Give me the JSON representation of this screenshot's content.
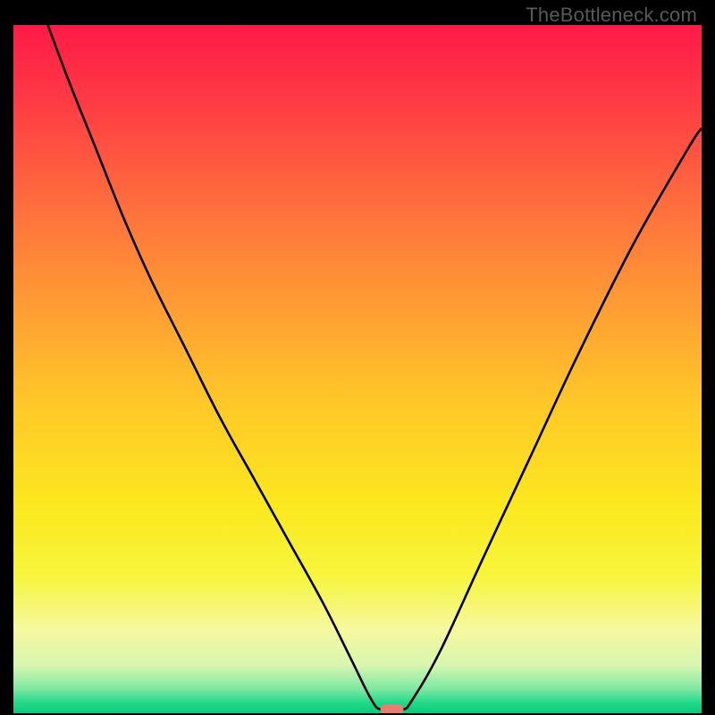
{
  "watermark": "TheBottleneck.com",
  "chart_data": {
    "type": "line",
    "title": "",
    "xlabel": "",
    "ylabel": "",
    "xlim": [
      0,
      100
    ],
    "ylim": [
      0,
      100
    ],
    "grid": false,
    "background_gradient": {
      "stops": [
        {
          "offset": 0.0,
          "color": "#ff1a48"
        },
        {
          "offset": 0.1,
          "color": "#ff3745"
        },
        {
          "offset": 0.25,
          "color": "#ff6a3e"
        },
        {
          "offset": 0.4,
          "color": "#ff9a35"
        },
        {
          "offset": 0.55,
          "color": "#ffc828"
        },
        {
          "offset": 0.7,
          "color": "#fbe81f"
        },
        {
          "offset": 0.8,
          "color": "#f7f53c"
        },
        {
          "offset": 0.88,
          "color": "#f5f8a0"
        },
        {
          "offset": 0.93,
          "color": "#d8f6b0"
        },
        {
          "offset": 0.965,
          "color": "#7de8a2"
        },
        {
          "offset": 0.985,
          "color": "#1fd989"
        },
        {
          "offset": 1.0,
          "color": "#0fc87a"
        }
      ]
    },
    "series": [
      {
        "name": "bottleneck-curve",
        "color": "#000000",
        "x": [
          5,
          8,
          12,
          16,
          20,
          25,
          30,
          35,
          40,
          45,
          49,
          52,
          53.5,
          56.5,
          58,
          62,
          68,
          75,
          82,
          90,
          98,
          100
        ],
        "y": [
          100,
          92,
          82,
          72,
          63,
          53,
          43,
          34,
          25,
          16,
          8,
          2,
          0.5,
          0.5,
          2,
          9,
          22,
          37,
          52,
          68,
          82,
          85
        ]
      }
    ],
    "marker": {
      "name": "optimal-point",
      "x": 55,
      "y": 0.5,
      "color": "#e77d73",
      "shape": "rounded-rect"
    }
  }
}
